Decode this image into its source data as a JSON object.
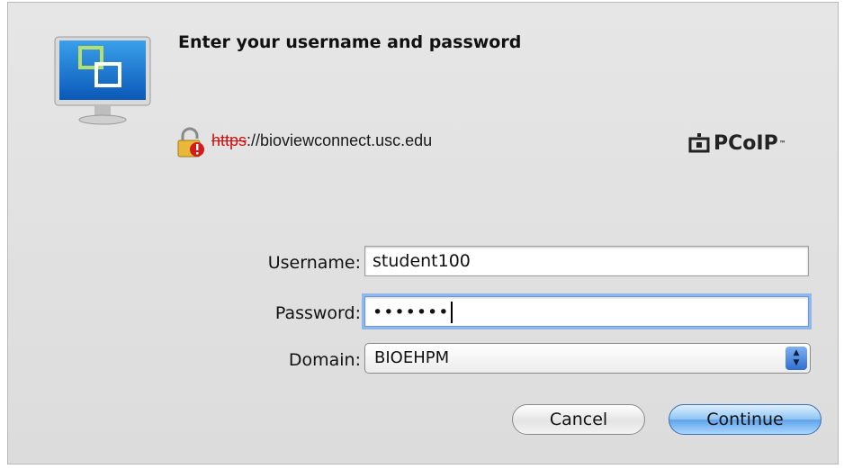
{
  "dialog": {
    "title": "Enter your username and password",
    "url_scheme": "https",
    "url_rest": "://bioviewconnect.usc.edu",
    "brand": "PCoIP",
    "brand_tm": "™",
    "app_icon": "monitor-windows-icon",
    "lock_icon": "broken-lock-warning-icon"
  },
  "form": {
    "username_label": "Username:",
    "username_value": "student100",
    "password_label": "Password:",
    "password_masked": "•••••••",
    "domain_label": "Domain:",
    "domain_value": "BIOEHPM",
    "stepper_up": "▲",
    "stepper_down": "▼"
  },
  "buttons": {
    "cancel": "Cancel",
    "continue": "Continue"
  },
  "colors": {
    "accent": "#5fa3ea",
    "url_warning": "#d01010",
    "focus_ring": "#8fb7ec"
  }
}
